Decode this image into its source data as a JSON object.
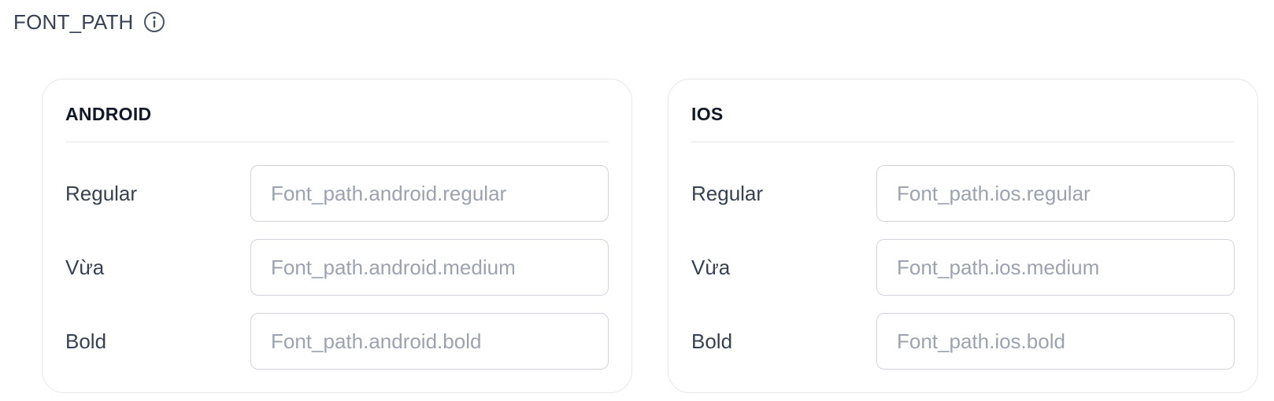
{
  "section": {
    "title": "FONT_PATH",
    "info_icon": "info-circle-icon"
  },
  "cards": {
    "android": {
      "title": "ANDROID",
      "fields": [
        {
          "label": "Regular",
          "value": "",
          "placeholder": "Font_path.android.regular"
        },
        {
          "label": "Vừa",
          "value": "",
          "placeholder": "Font_path.android.medium"
        },
        {
          "label": "Bold",
          "value": "",
          "placeholder": "Font_path.android.bold"
        }
      ]
    },
    "ios": {
      "title": "IOS",
      "fields": [
        {
          "label": "Regular",
          "value": "",
          "placeholder": "Font_path.ios.regular"
        },
        {
          "label": "Vừa",
          "value": "",
          "placeholder": "Font_path.ios.medium"
        },
        {
          "label": "Bold",
          "value": "",
          "placeholder": "Font_path.ios.bold"
        }
      ]
    }
  },
  "colors": {
    "text_primary": "#111827",
    "text_label": "#374151",
    "placeholder": "#9ca3af",
    "border": "#d1d5db",
    "card_border": "#e5e7eb"
  }
}
